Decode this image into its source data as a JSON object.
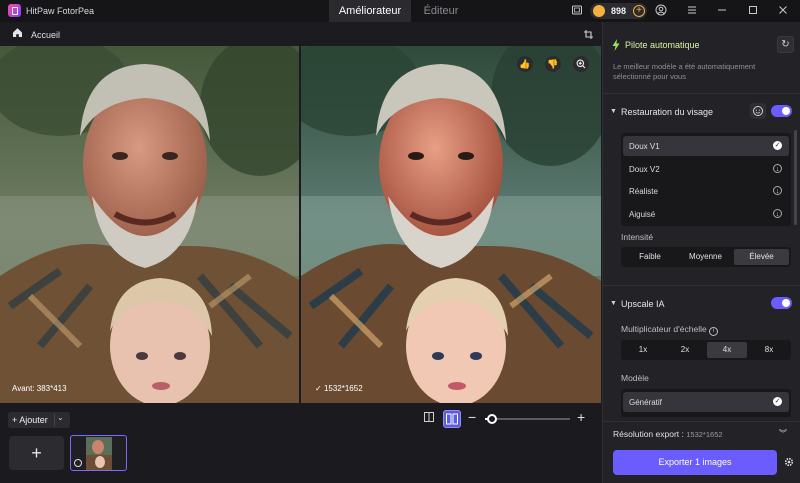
{
  "app": {
    "name": "HitPaw FotorPea"
  },
  "tabs": [
    {
      "label": "Améliorateur",
      "active": true
    },
    {
      "label": "Éditeur",
      "active": false
    }
  ],
  "coins": {
    "value": "898"
  },
  "toolbar": {
    "home_label": "Accueil"
  },
  "preview": {
    "before_label": "Avant: 383*413",
    "after_label": "1532*1652"
  },
  "bottom": {
    "add_label": "Ajouter",
    "zoom_percent": 8
  },
  "panel": {
    "pilot_title": "Pilote automatique",
    "pilot_desc": "Le meilleur modèle a été automatiquement sélectionné pour vous",
    "face_section": {
      "title": "Restauration du visage",
      "enabled": true,
      "models": [
        "Doux V1",
        "Doux V2",
        "Réaliste",
        "Aiguisé"
      ],
      "selected": 0
    },
    "intensity": {
      "label": "Intensité",
      "options": [
        "Faible",
        "Moyenne",
        "Élevée"
      ],
      "selected": 2
    },
    "upscale_section": {
      "title": "Upscale IA",
      "enabled": true
    },
    "scale": {
      "label": "Multiplicateur d'échelle",
      "options": [
        "1x",
        "2x",
        "4x",
        "8x"
      ],
      "selected": 2
    },
    "model": {
      "label": "Modèle",
      "selected_name": "Génératif"
    },
    "export_res": {
      "label": "Résolution export :",
      "value": "1532*1652"
    },
    "export_button": "Exporter 1 images"
  },
  "colors": {
    "accent": "#6a5cff",
    "coin": "#f4b13d",
    "pilot": "#9be25a"
  }
}
